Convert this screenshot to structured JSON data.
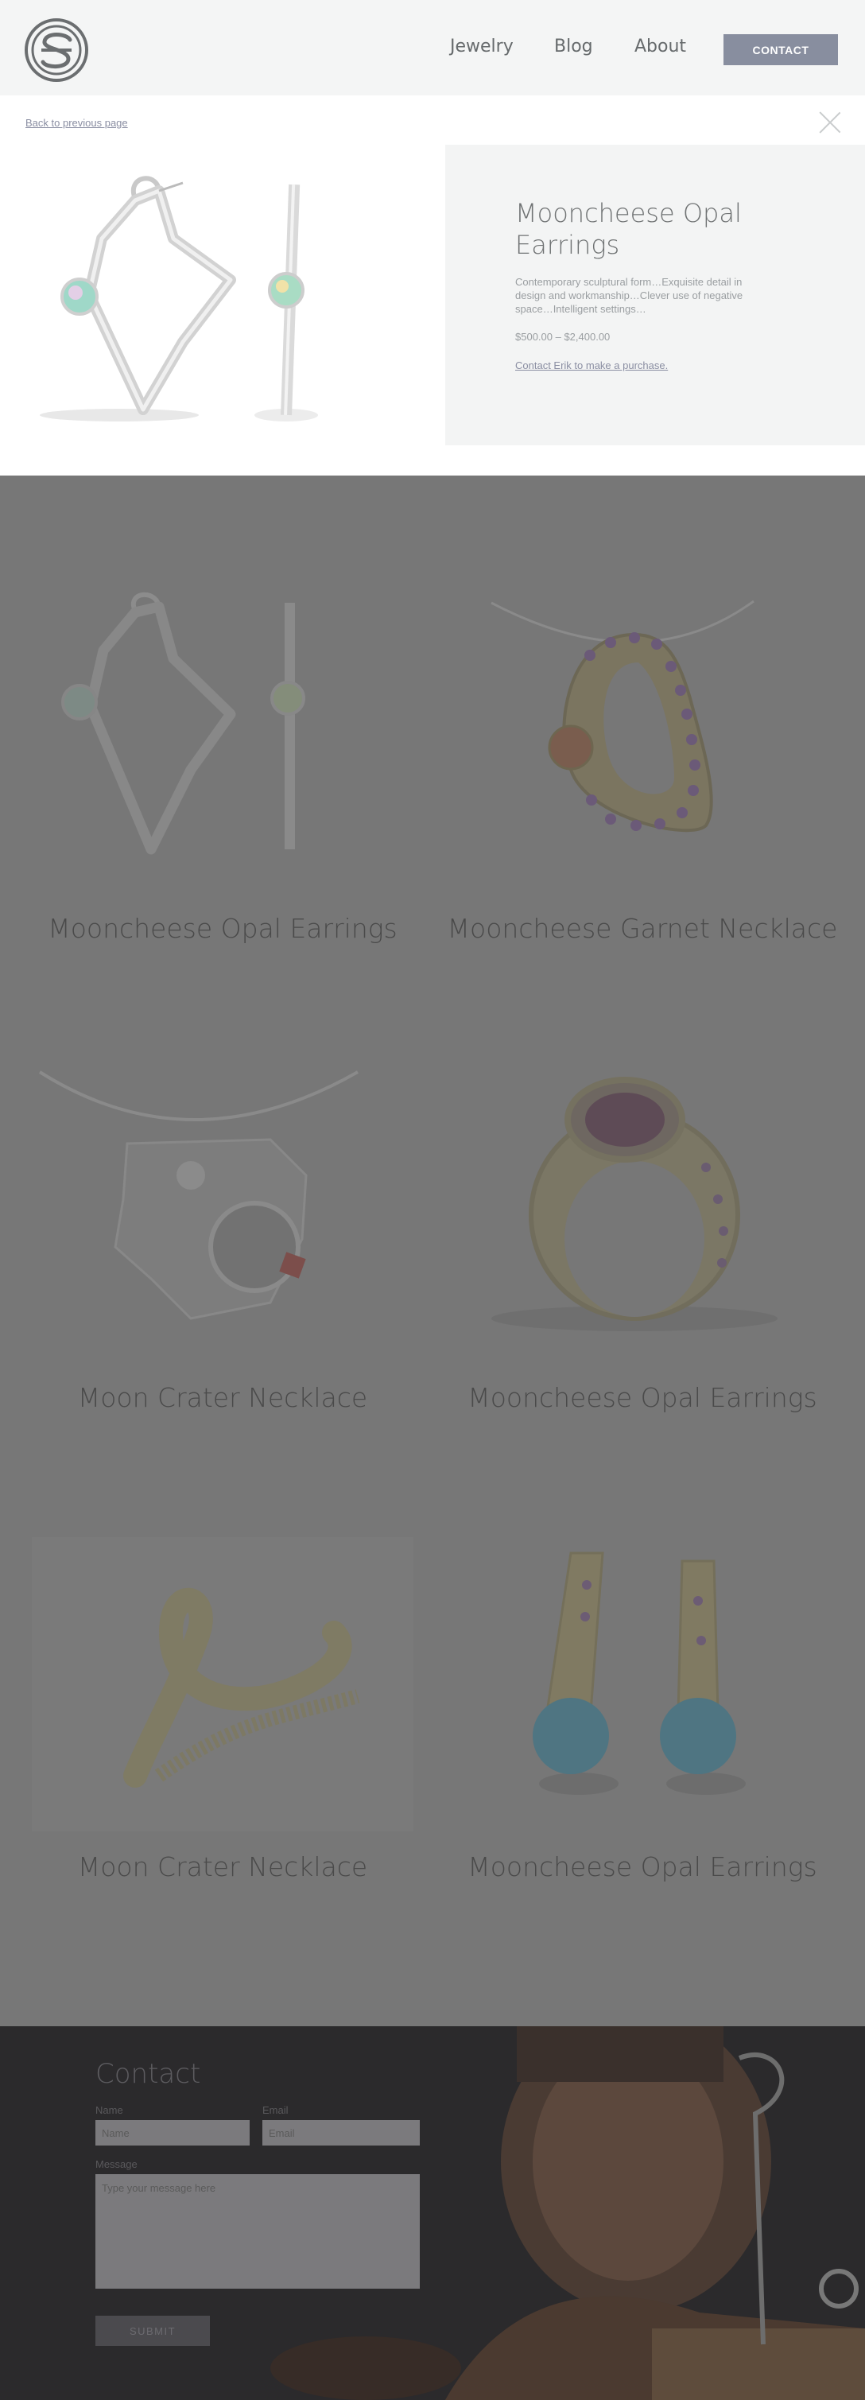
{
  "header": {
    "nav": {
      "jewelry": "Jewelry",
      "blog": "Blog",
      "about": "About"
    },
    "contact_button": "CONTACT"
  },
  "modal": {
    "back_link": "Back to previous page",
    "title": "Mooncheese Opal Earrings",
    "description": "Contemporary sculptural form…Exquisite detail in design and workmanship…Clever use of negative space…Intelligent settings…",
    "price": "$500.00 – $2,400.00",
    "purchase_link": "Contact Erik to make a purchase."
  },
  "gallery": {
    "items": [
      {
        "title": "Mooncheese Opal Earrings"
      },
      {
        "title": "Mooncheese Garnet Necklace"
      },
      {
        "title": "Moon Crater Necklace"
      },
      {
        "title": "Mooncheese Opal Earrings"
      },
      {
        "title": "Moon Crater Necklace"
      },
      {
        "title": "Mooncheese Opal Earrings"
      }
    ]
  },
  "contact": {
    "heading": "Contact",
    "name_label": "Name",
    "name_placeholder": "Name",
    "email_label": "Email",
    "email_placeholder": "Email",
    "message_label": "Message",
    "message_placeholder": "Type your message here",
    "submit_label": "SUBMIT"
  },
  "colors": {
    "header_bg": "#f4f5f5",
    "accent_button": "#888e9f",
    "overlay_gray": "#777777",
    "contact_bg": "#2b2a2c"
  }
}
